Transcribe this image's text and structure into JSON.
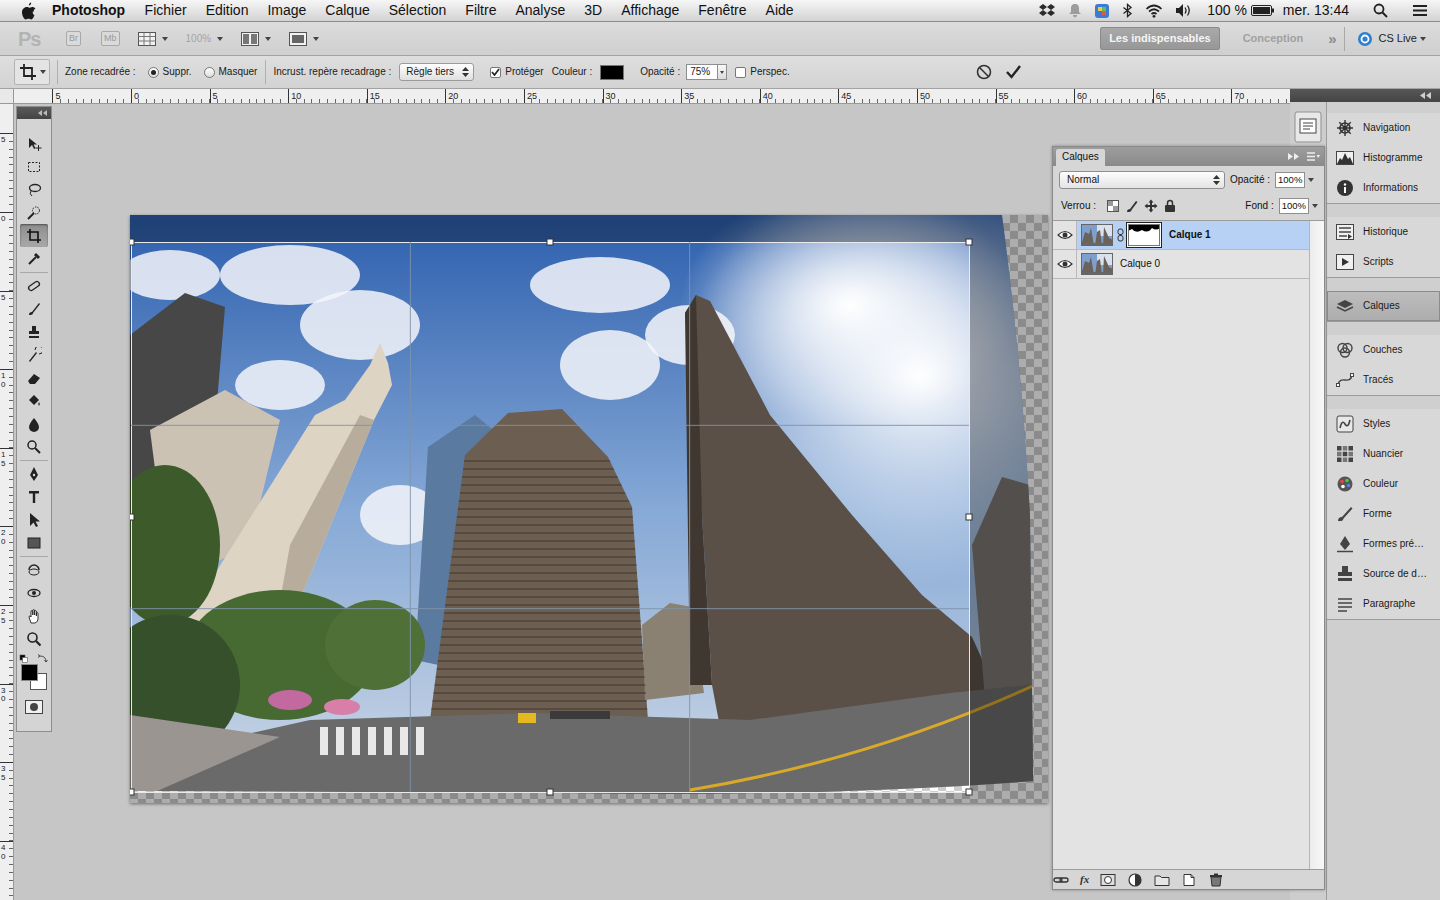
{
  "menubar": {
    "app": "Photoshop",
    "items": [
      "Fichier",
      "Edition",
      "Image",
      "Calque",
      "Sélection",
      "Filtre",
      "Analyse",
      "3D",
      "Affichage",
      "Fenêtre",
      "Aide"
    ],
    "battery": "100 %",
    "battery_level": 1,
    "clock": "mer. 13:44"
  },
  "appbar": {
    "logo": "Ps",
    "bridge": "Br",
    "mini_bridge": "Mb",
    "zoom": "100%",
    "zoom_disabled": true,
    "workspaces": [
      {
        "label": "Les indispensables",
        "selected": true
      },
      {
        "label": "Conception",
        "selected": false
      }
    ],
    "more": "»",
    "cs_live": "CS Live"
  },
  "options": {
    "crop_area_label": "Zone recadrée :",
    "crop_modes": [
      {
        "label": "Suppr.",
        "selected": true
      },
      {
        "label": "Masquer",
        "selected": false
      }
    ],
    "overlay_label": "Incrust. repère recadrage :",
    "overlay": "Règle tiers",
    "shield": {
      "label": "Protéger",
      "checked": true
    },
    "color_label": "Couleur :",
    "shield_color": "#000000",
    "opacity_label": "Opacité :",
    "opacity": "75%",
    "perspective": {
      "label": "Perspec.",
      "checked": false
    }
  },
  "rulers": {
    "horizontal": [
      "5",
      "0",
      "5",
      "10",
      "15",
      "20",
      "25",
      "30",
      "35",
      "40",
      "45",
      "50",
      "55",
      "60",
      "65",
      "70"
    ],
    "vertical": [
      "5",
      "0",
      "5",
      "10",
      "15",
      "20",
      "25",
      "30",
      "35",
      "40"
    ]
  },
  "tools_panel": {
    "tools": [
      {
        "kind": "move",
        "selected": false
      },
      {
        "kind": "marquee",
        "selected": false
      },
      {
        "kind": "lasso",
        "selected": false
      },
      {
        "kind": "quickselect",
        "selected": false
      },
      {
        "kind": "crop",
        "selected": true
      },
      {
        "kind": "eyedropper",
        "selected": false
      },
      {
        "kind": "heal",
        "selected": false
      },
      {
        "kind": "brush",
        "selected": false
      },
      {
        "kind": "stamp",
        "selected": false
      },
      {
        "kind": "historybrush",
        "selected": false
      },
      {
        "kind": "eraser",
        "selected": false
      },
      {
        "kind": "bucket",
        "selected": false
      },
      {
        "kind": "blur",
        "selected": false
      },
      {
        "kind": "dodge",
        "selected": false
      },
      {
        "kind": "pen",
        "selected": false
      },
      {
        "kind": "type",
        "selected": false
      },
      {
        "kind": "pathselect",
        "selected": false
      },
      {
        "kind": "shape",
        "selected": false
      },
      {
        "kind": "rotate3d",
        "selected": false
      },
      {
        "kind": "orbit3d",
        "selected": false
      },
      {
        "kind": "hand",
        "selected": false
      },
      {
        "kind": "zoom",
        "selected": false
      }
    ],
    "foreground": "#000000",
    "background": "#ffffff"
  },
  "layers_panel": {
    "tab": "Calques",
    "blend_mode": "Normal",
    "opacity_label": "Opacité :",
    "opacity": "100%",
    "lock_label": "Verrou :",
    "fill_label": "Fond :",
    "fill": "100%",
    "layers": [
      {
        "name": "Calque 1",
        "selected": true,
        "visible": true,
        "has_mask": true
      },
      {
        "name": "Calque 0",
        "selected": false,
        "visible": true,
        "has_mask": false
      }
    ],
    "footer_fx": "fx"
  },
  "dock": {
    "groups": [
      {
        "items": [
          {
            "label": "Navigation",
            "kind": "navigation",
            "selected": false
          },
          {
            "label": "Histogramme",
            "kind": "histogram",
            "selected": false
          },
          {
            "label": "Informations",
            "kind": "info",
            "selected": false
          }
        ]
      },
      {
        "items": [
          {
            "label": "Historique",
            "kind": "history",
            "selected": false
          },
          {
            "label": "Scripts",
            "kind": "scripts",
            "selected": false
          }
        ]
      },
      {
        "items": [
          {
            "label": "Calques",
            "kind": "layers",
            "selected": true
          }
        ]
      },
      {
        "items": [
          {
            "label": "Couches",
            "kind": "channels",
            "selected": false
          },
          {
            "label": "Tracés",
            "kind": "paths",
            "selected": false
          }
        ]
      },
      {
        "items": [
          {
            "label": "Styles",
            "kind": "styles",
            "selected": false
          },
          {
            "label": "Nuancier",
            "kind": "swatches",
            "selected": false
          },
          {
            "label": "Couleur",
            "kind": "color",
            "selected": false
          },
          {
            "label": "Forme",
            "kind": "brush",
            "selected": false
          },
          {
            "label": "Formes pré…",
            "kind": "presets",
            "selected": false
          },
          {
            "label": "Source de d…",
            "kind": "clone",
            "selected": false
          },
          {
            "label": "Paragraphe",
            "kind": "paragraph",
            "selected": false
          }
        ]
      }
    ]
  }
}
